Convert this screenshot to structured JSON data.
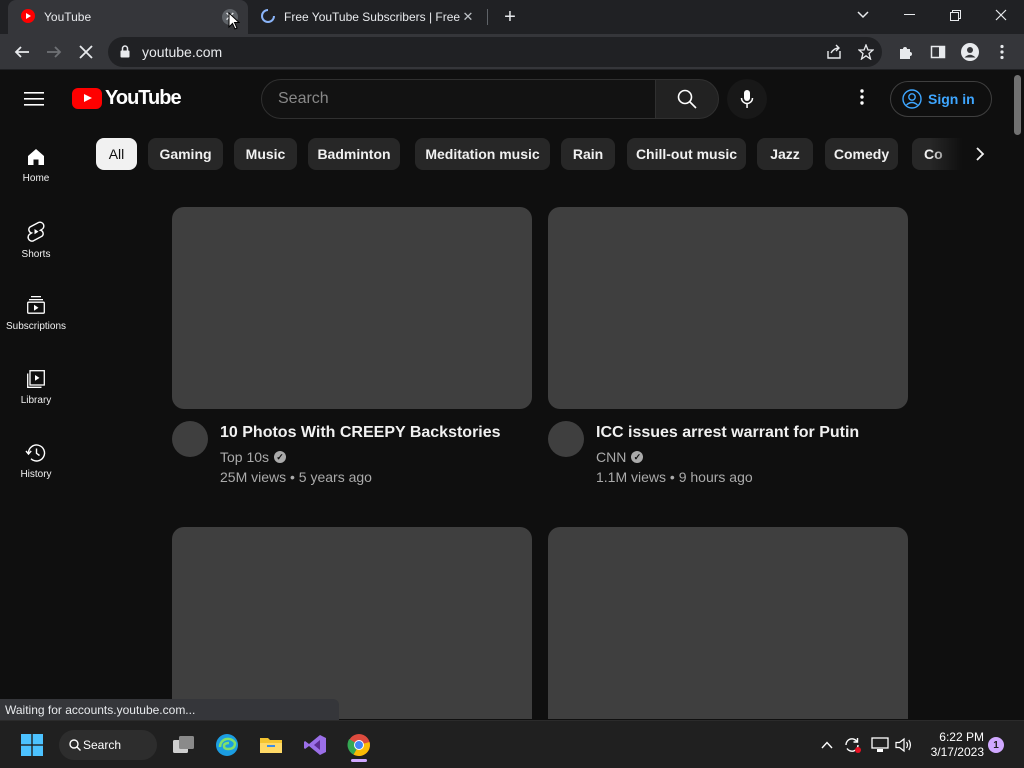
{
  "browser": {
    "tabs": [
      {
        "title": "YouTube",
        "active": true
      },
      {
        "title": "Free YouTube Subscribers | Free Y",
        "active": false
      }
    ],
    "url": "youtube.com",
    "status_text": "Waiting for accounts.youtube.com..."
  },
  "youtube": {
    "logo_text": "YouTube",
    "search_placeholder": "Search",
    "signin_label": "Sign in",
    "chips": [
      "All",
      "Gaming",
      "Music",
      "Badminton",
      "Meditation music",
      "Rain",
      "Chill-out music",
      "Jazz",
      "Comedy",
      "Co"
    ],
    "selected_chip": "All",
    "guide": [
      {
        "label": "Home",
        "icon": "home-icon"
      },
      {
        "label": "Shorts",
        "icon": "shorts-icon"
      },
      {
        "label": "Subscriptions",
        "icon": "subscriptions-icon"
      },
      {
        "label": "Library",
        "icon": "library-icon"
      },
      {
        "label": "History",
        "icon": "history-icon"
      }
    ],
    "videos": [
      {
        "title": "10 Photos With CREEPY Backstories",
        "channel": "Top 10s",
        "verified": true,
        "stats": "25M views • 5 years ago"
      },
      {
        "title": "ICC issues arrest warrant for Putin",
        "channel": "CNN",
        "verified": true,
        "stats": "1.1M views • 9 hours ago"
      },
      {
        "title": "",
        "channel": "",
        "verified": false,
        "stats": ""
      },
      {
        "title": "",
        "channel": "",
        "verified": false,
        "stats": ""
      }
    ]
  },
  "taskbar": {
    "search_label": "Search",
    "time": "6:22 PM",
    "date": "3/17/2023",
    "notification_count": "1"
  },
  "colors": {
    "youtube_red": "#ff0000",
    "background": "#0f0f0f",
    "link_blue": "#3ea6ff",
    "placeholder_gray": "#3f3f3f"
  }
}
